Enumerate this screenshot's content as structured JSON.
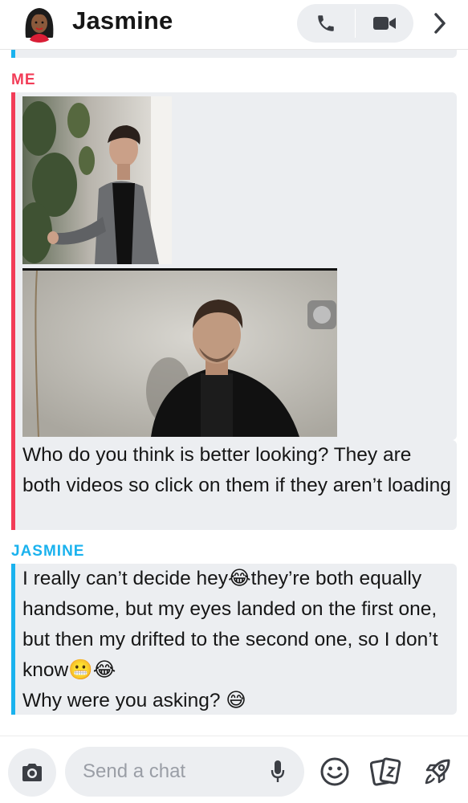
{
  "header": {
    "contact_name": "Jasmine",
    "avatar_icon": "bitmoji-avatar-icon",
    "call_icon": "phone-icon",
    "video_icon": "video-camera-icon",
    "more_icon": "chevron-right-icon"
  },
  "colors": {
    "me": "#f23c57",
    "jasmine": "#1ab2ee",
    "bubble": "#eceef1"
  },
  "messages": [
    {
      "sender": "ME",
      "media": [
        "video-thumbnail-man-grey-suit",
        "video-thumbnail-man-black-blazer"
      ],
      "text": "Who do you think is better looking? They are both videos so click on them if they aren’t loading"
    },
    {
      "sender": "JASMINE",
      "text": "I really can’t decide hey😂they’re both equally handsome, but my eyes landed on the first one, but then my drifted to the second one, so I don’t know😬😂\nWhy were you asking? 😅"
    }
  ],
  "composer": {
    "placeholder": "Send a chat",
    "camera_icon": "camera-icon",
    "mic_icon": "microphone-icon",
    "emoji_icon": "smiley-icon",
    "cards_icon": "cards-icon",
    "rocket_icon": "rocket-icon"
  }
}
